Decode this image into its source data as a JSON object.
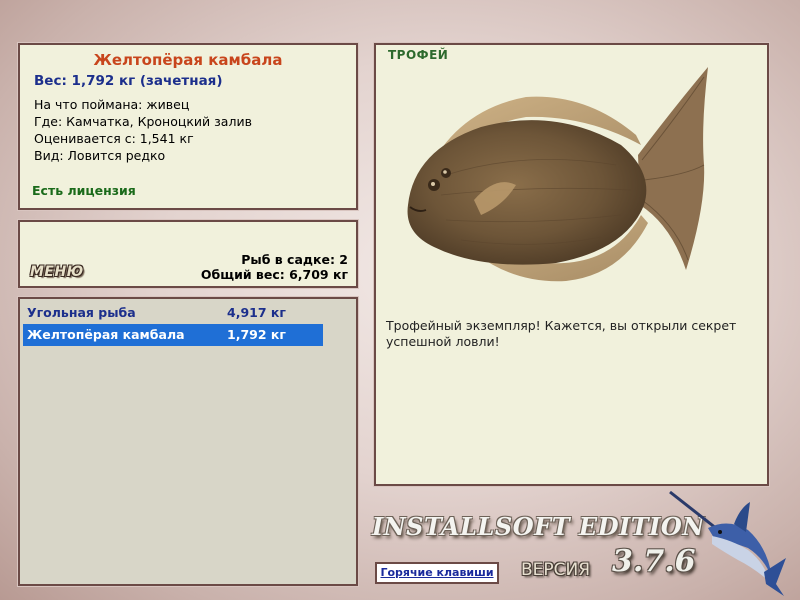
{
  "fish_info": {
    "title": "Желтопёрая камбала",
    "weight_line": "Вес: 1,792 кг (зачетная)",
    "lines": [
      "На что поймана: живец",
      "Где: Камчатка, Кроноцкий залив",
      "Оценивается с: 1,541 кг",
      "Вид: Ловится редко"
    ],
    "license": "Есть лицензия"
  },
  "menu": {
    "button_label": "МЕНЮ",
    "fish_in_keepnet": "Рыб в садке: 2",
    "total_weight": "Общий вес: 6,709 кг"
  },
  "catch_list": [
    {
      "name": "Угольная рыба",
      "weight": "4,917 кг",
      "selected": false
    },
    {
      "name": "Желтопёрая камбала",
      "weight": "1,792 кг",
      "selected": true
    }
  ],
  "trophy": {
    "label": "ТРОФЕЙ",
    "description": "Трофейный экземпляр! Кажется, вы открыли секрет успешной ловли!"
  },
  "footer": {
    "edition": "INSTALLSOFT EDITION",
    "version_label": "ВЕРСИЯ",
    "version_number": "3.7.6",
    "hotkeys_label": "Горячие клавиши"
  },
  "colors": {
    "panel_bg": "#f1f1dc",
    "panel_border": "#6b4a46",
    "title_orange": "#c8451c",
    "weight_blue": "#1c2f8c",
    "license_green": "#1a6a1a",
    "selection_blue": "#1f6fd6"
  }
}
